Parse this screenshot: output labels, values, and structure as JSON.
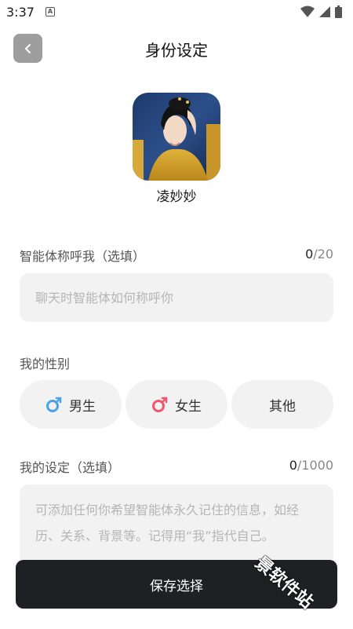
{
  "status_bar": {
    "time": "3:37",
    "icons": [
      "wifi-icon",
      "signal-icon",
      "battery-icon"
    ]
  },
  "header": {
    "title": "身份设定",
    "back_icon": "chevron-left-icon"
  },
  "agent": {
    "name": "凌妙妙"
  },
  "nickname_field": {
    "label": "智能体称呼我（选填）",
    "count_current": "0",
    "count_max": "/20",
    "placeholder": "聊天时智能体如何称呼你",
    "value": ""
  },
  "gender": {
    "label": "我的性别",
    "options": [
      {
        "label": "男生",
        "icon": "male-icon",
        "color": "#4aa3e8"
      },
      {
        "label": "女生",
        "icon": "female-icon",
        "color": "#f0566e"
      },
      {
        "label": "其他"
      }
    ]
  },
  "profile_field": {
    "label": "我的设定（选填）",
    "count_current": "0",
    "count_max": "/1000",
    "placeholder": "可添加任何你希望智能体永久记住的信息，如经历、关系、背景等。记得用“我”指代自己。",
    "value": ""
  },
  "actions": {
    "save_label": "保存选择"
  },
  "watermark": "景软件站",
  "colors": {
    "primary_button": "#1e2023",
    "input_bg": "#f2f2f2",
    "back_button": "#9e9e9e"
  }
}
